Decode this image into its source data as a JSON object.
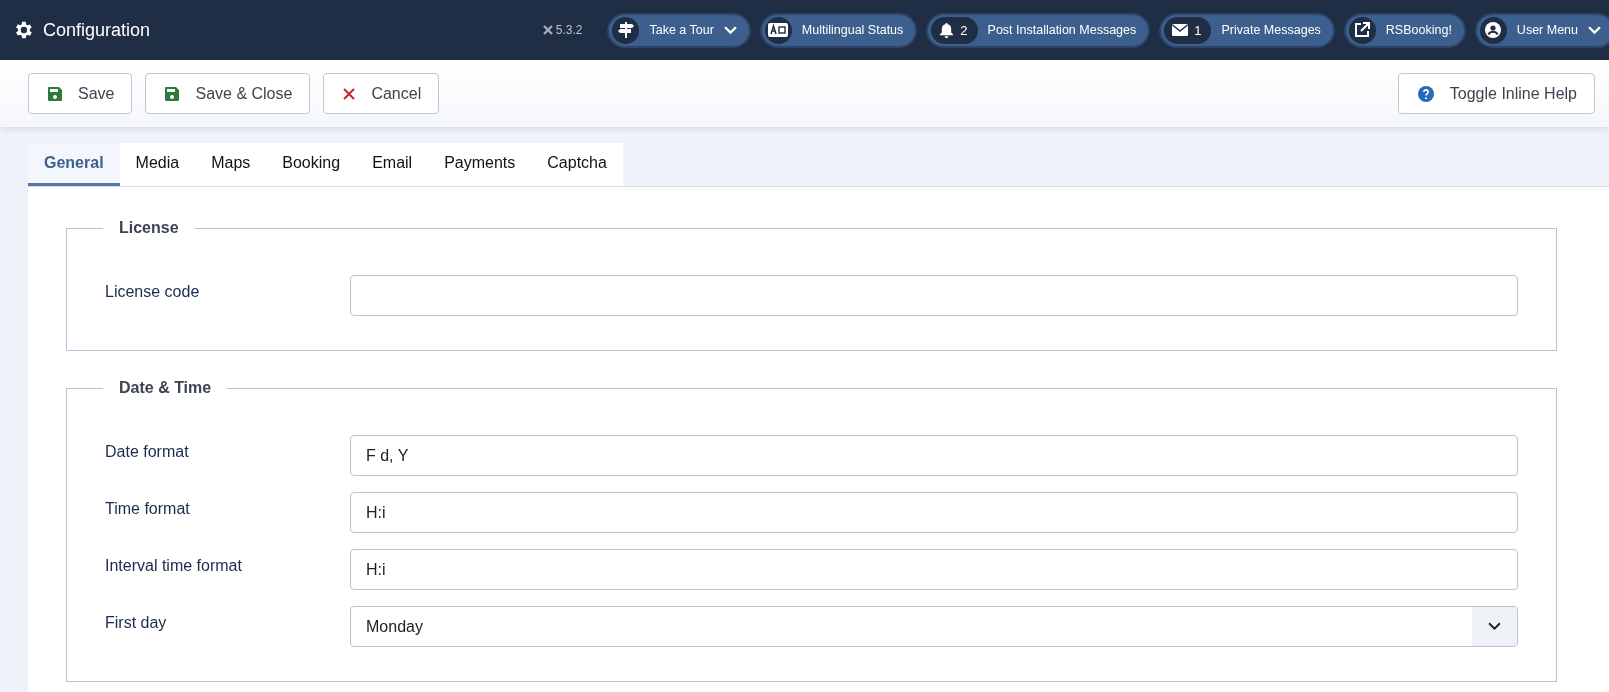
{
  "header": {
    "title": "Configuration",
    "version": "5.3.2",
    "items": [
      {
        "kind": "tour",
        "label": "Take a Tour",
        "dropdown": true
      },
      {
        "kind": "language",
        "label": "Multilingual Status",
        "dropdown": false
      },
      {
        "kind": "bell",
        "count": "2",
        "label": "Post Installation Messages",
        "dropdown": false
      },
      {
        "kind": "mail",
        "count": "1",
        "label": "Private Messages",
        "dropdown": false
      },
      {
        "kind": "external",
        "label": "RSBooking!",
        "dropdown": false
      },
      {
        "kind": "user",
        "label": "User Menu",
        "dropdown": true
      }
    ]
  },
  "toolbar": {
    "buttons": [
      {
        "kind": "save",
        "label": "Save"
      },
      {
        "kind": "save",
        "label": "Save & Close"
      },
      {
        "kind": "cancel",
        "label": "Cancel"
      }
    ],
    "help": {
      "label": "Toggle Inline Help"
    }
  },
  "tabs": [
    {
      "label": "General",
      "selected": true
    },
    {
      "label": "Media",
      "selected": false
    },
    {
      "label": "Maps",
      "selected": false
    },
    {
      "label": "Booking",
      "selected": false
    },
    {
      "label": "Email",
      "selected": false
    },
    {
      "label": "Payments",
      "selected": false
    },
    {
      "label": "Captcha",
      "selected": false
    }
  ],
  "fieldsets": [
    {
      "legend": "License",
      "fields": [
        {
          "kind": "text",
          "label": "License code"
        }
      ]
    },
    {
      "legend": "Date & Time",
      "fields": [
        {
          "kind": "text",
          "label": "Date format",
          "value": "F d, Y"
        },
        {
          "kind": "text",
          "label": "Time format",
          "value": "H:i"
        },
        {
          "kind": "text",
          "label": "Interval time format",
          "value": "H:i"
        },
        {
          "kind": "select",
          "label": "First day",
          "value": "Monday"
        }
      ]
    }
  ]
}
